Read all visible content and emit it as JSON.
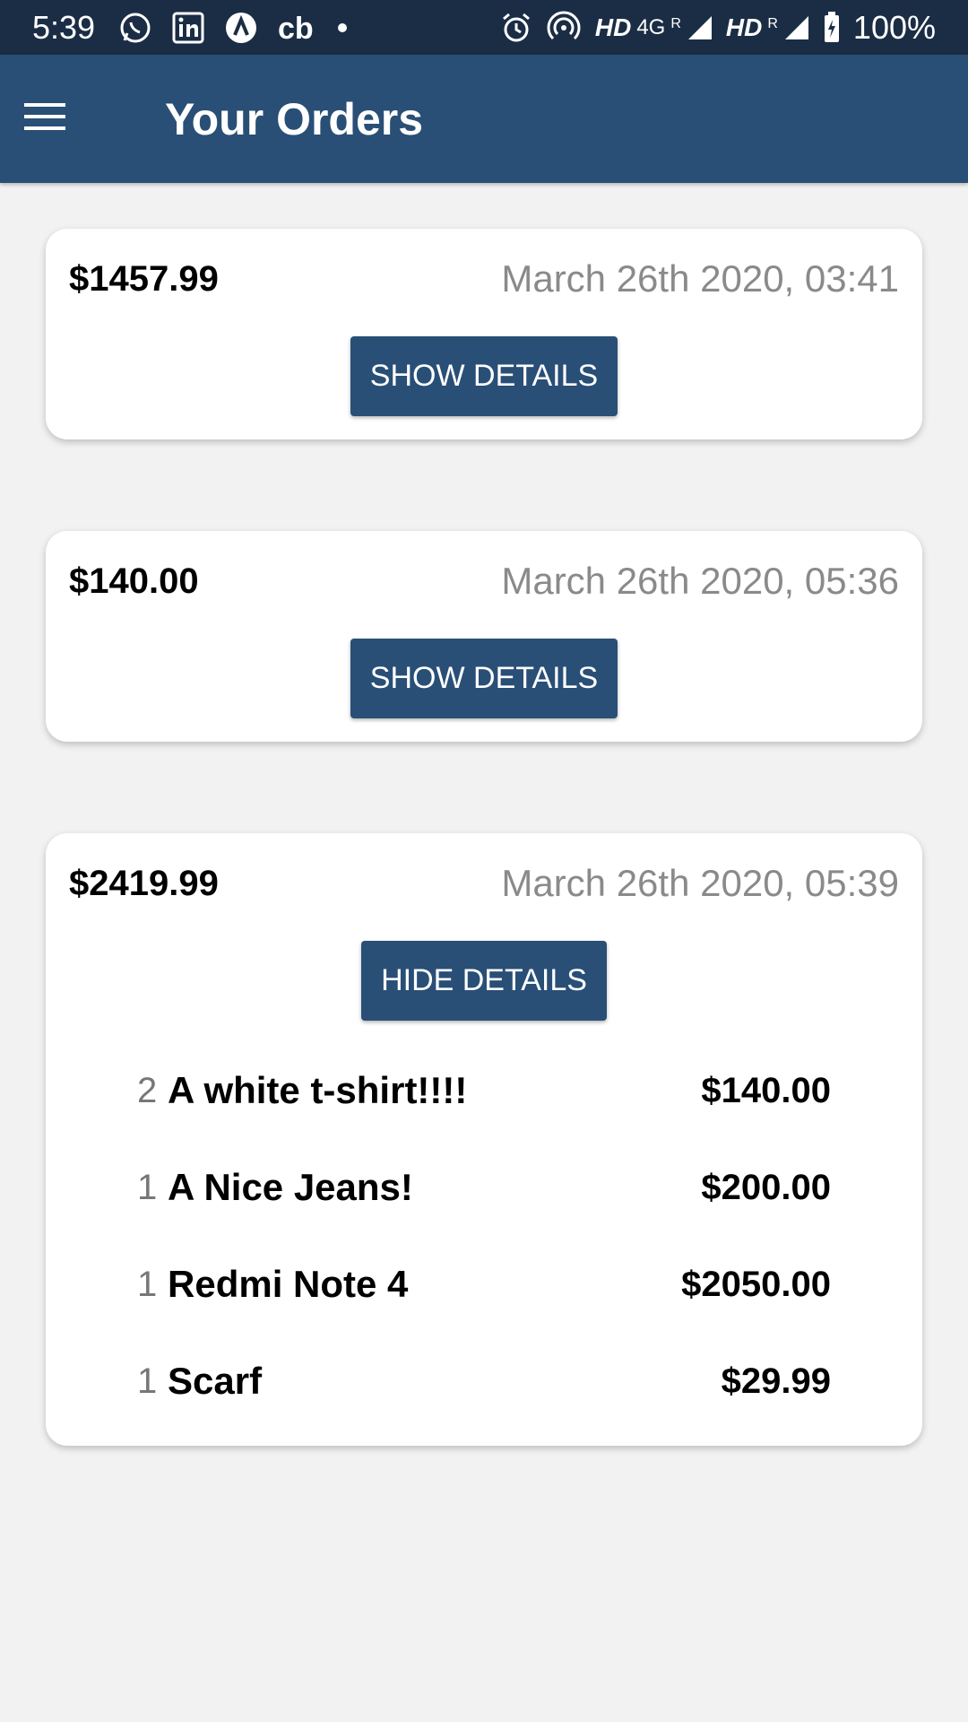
{
  "status_bar": {
    "time": "5:39",
    "icons": [
      "whatsapp-icon",
      "linkedin-icon",
      "app-icon",
      "cb-icon",
      "dot-icon",
      "alarm-icon",
      "hotspot-icon",
      "signal-icon",
      "signal-icon",
      "battery-charging-icon"
    ],
    "network1": "HD",
    "network_type": "4G",
    "roaming1": "R",
    "network2": "HD",
    "roaming2": "R",
    "battery": "100%"
  },
  "app_bar": {
    "title": "Your Orders",
    "menu_icon": "hamburger-menu-icon"
  },
  "colors": {
    "primary": "#294f76",
    "status_bar": "#1b2d45",
    "background": "#f2f2f2"
  },
  "orders": [
    {
      "total": "$1457.99",
      "date": "March 26th 2020, 03:41",
      "button_label": "SHOW DETAILS",
      "expanded": false
    },
    {
      "total": "$140.00",
      "date": "March 26th 2020, 05:36",
      "button_label": "SHOW DETAILS",
      "expanded": false
    },
    {
      "total": "$2419.99",
      "date": "March 26th 2020, 05:39",
      "button_label": "HIDE DETAILS",
      "expanded": true,
      "items": [
        {
          "qty": "2",
          "title": "A white t-shirt!!!!",
          "price": "$140.00"
        },
        {
          "qty": "1",
          "title": "A Nice Jeans!",
          "price": "$200.00"
        },
        {
          "qty": "1",
          "title": "Redmi Note 4",
          "price": "$2050.00"
        },
        {
          "qty": "1",
          "title": "Scarf",
          "price": "$29.99"
        }
      ]
    }
  ]
}
